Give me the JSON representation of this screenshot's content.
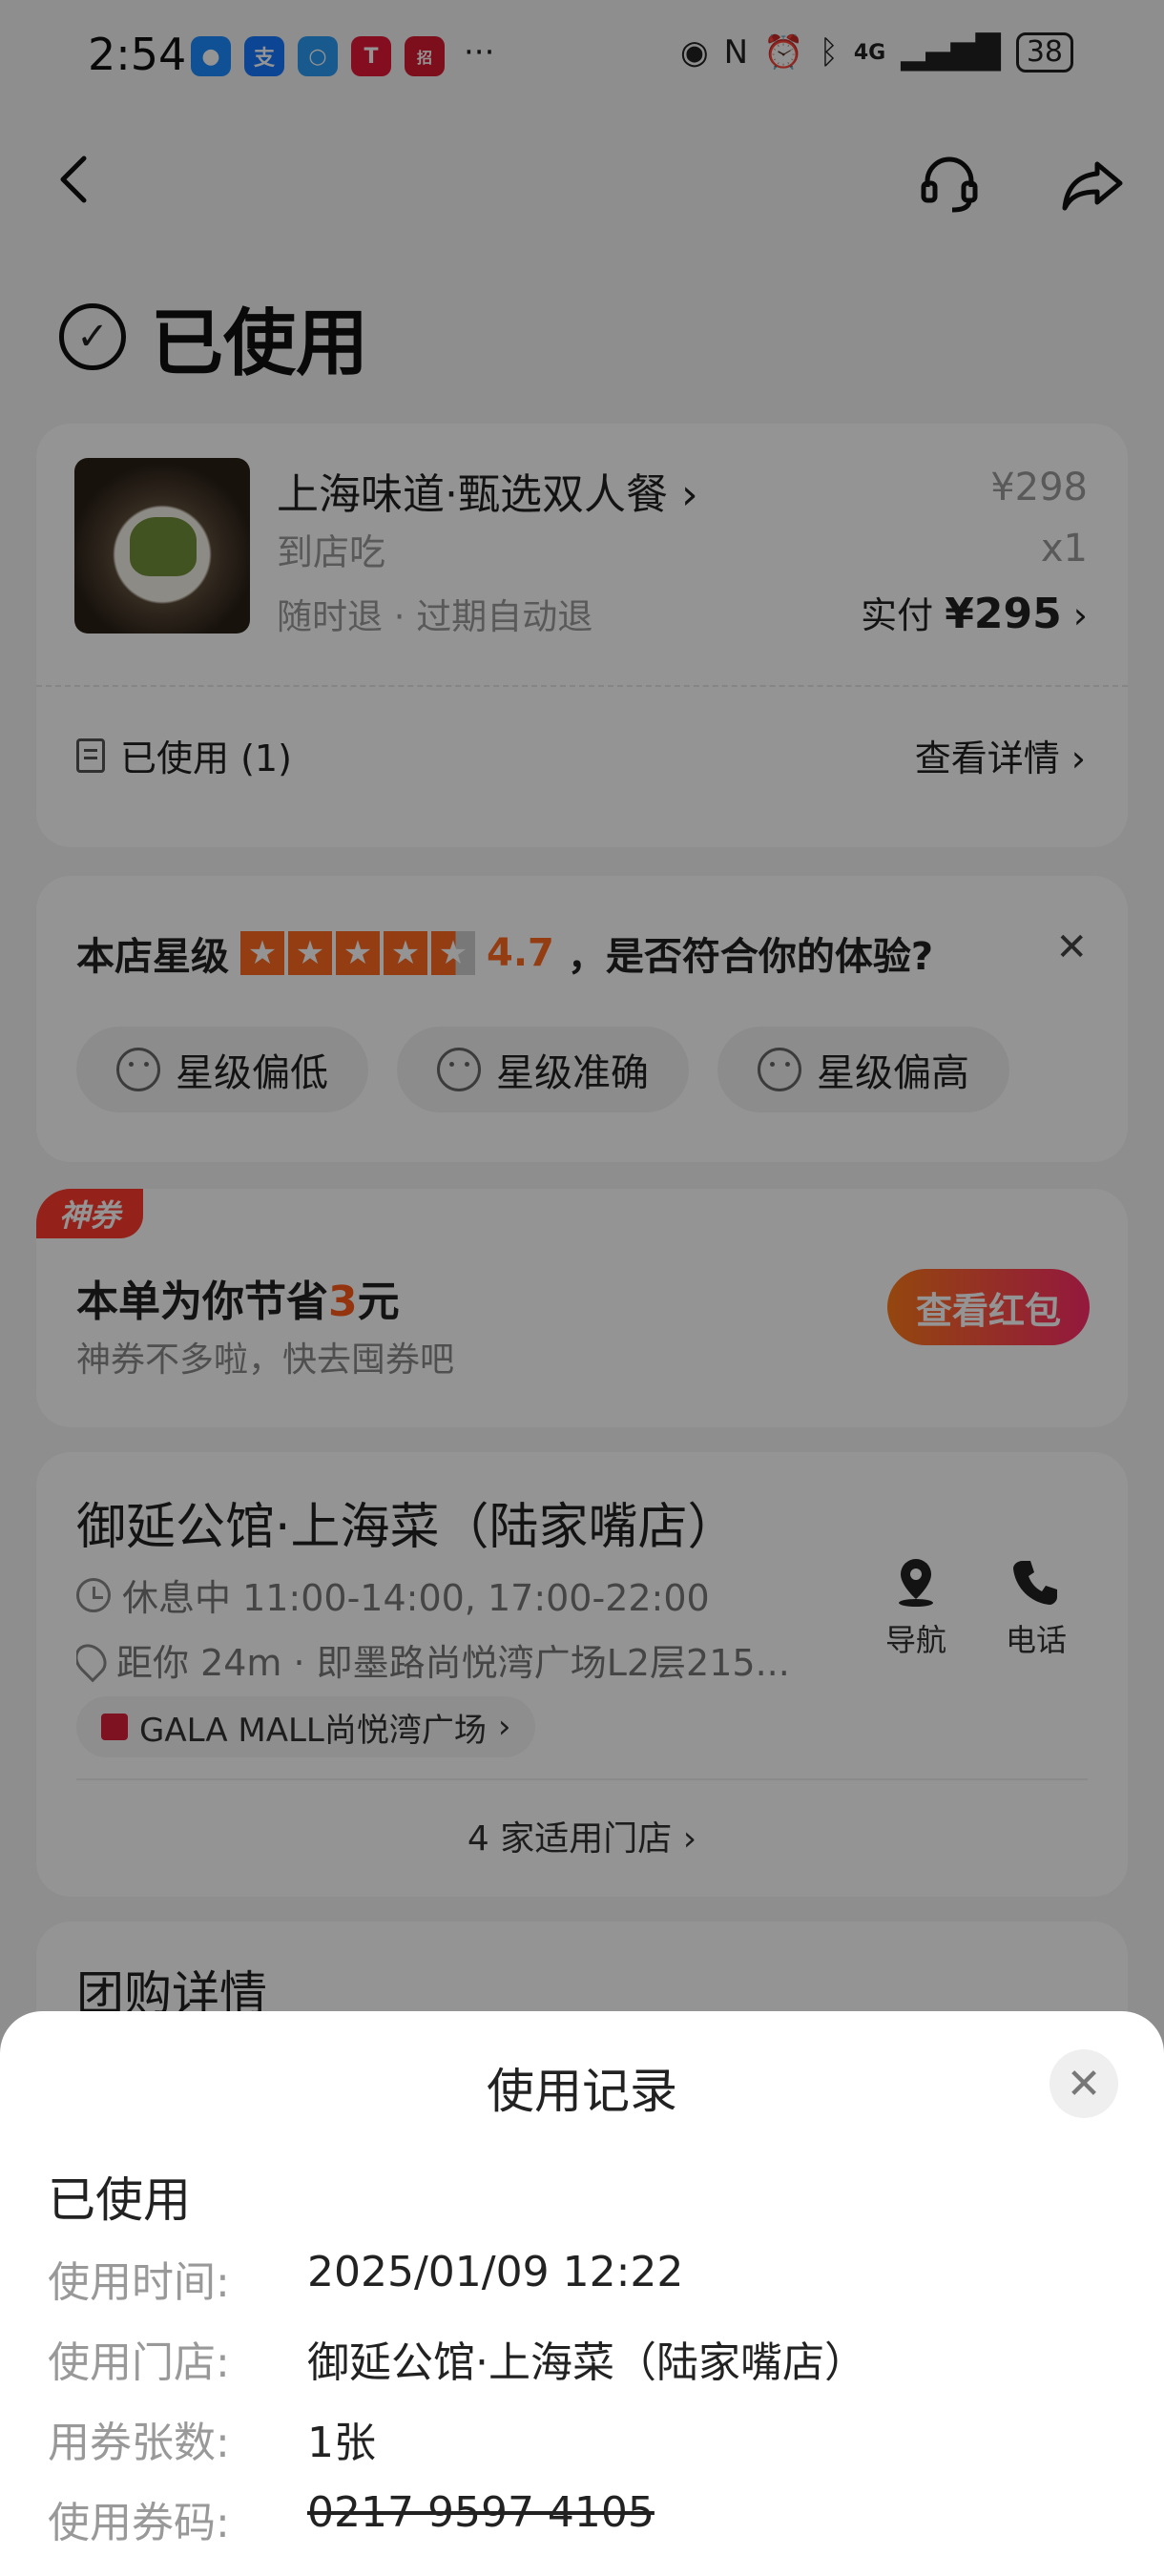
{
  "status_bar": {
    "time": "2:54",
    "more": "···",
    "network": "4G",
    "battery": "38"
  },
  "status": {
    "title": "已使用"
  },
  "order": {
    "product_title": "上海味道·甄选双人餐",
    "product_sub": "到店吃",
    "refund_policy": "随时退 · 过期自动退",
    "price_original": "¥298",
    "quantity": "x1",
    "paid_label": "实付",
    "paid_amount": "¥295",
    "used_label": "已使用 (1)",
    "view_detail": "查看详情"
  },
  "rating": {
    "label": "本店星级",
    "stars": 4.7,
    "score": "4.7",
    "question": "，是否符合你的体验?",
    "chips": [
      "星级偏低",
      "星级准确",
      "星级偏高"
    ]
  },
  "coupon": {
    "badge": "神券",
    "save_prefix": "本单为你节省",
    "save_amount": "3",
    "save_suffix": "元",
    "subtitle": "神券不多啦，快去囤券吧",
    "button": "查看红包"
  },
  "shop": {
    "name": "御延公馆·上海菜（陆家嘴店）",
    "hours": "休息中 11:00-14:00, 17:00-22:00",
    "address": "距你 24m · 即墨路尚悦湾广场L2层215...",
    "mall": "GALA MALL尚悦湾广场",
    "nav_label": "导航",
    "call_label": "电话",
    "stores_link": "4 家适用门店"
  },
  "group_detail": {
    "title": "团购详情"
  },
  "sheet": {
    "title": "使用记录",
    "status": "已使用",
    "rows": [
      {
        "label": "使用时间:",
        "value": "2025/01/09 12:22"
      },
      {
        "label": "使用门店:",
        "value": "御延公馆·上海菜（陆家嘴店）"
      },
      {
        "label": "用券张数:",
        "value": "1张"
      },
      {
        "label": "使用券码:",
        "value": "0217 9597 4105"
      }
    ]
  },
  "colors": {
    "accent": "#ff6a1f",
    "badge_red": "#ff3c2e",
    "button_gradient_start": "#ff7a1a",
    "button_gradient_end": "#ff2a6a",
    "overlay": "rgba(0,0,0,0.42)"
  },
  "icons": {
    "back": "chevron-left-icon",
    "customer_service": "headset-icon",
    "share": "share-arrow-icon",
    "status": "check-circle-icon",
    "close": "close-icon",
    "nav": "location-pin-icon",
    "call": "phone-icon"
  }
}
